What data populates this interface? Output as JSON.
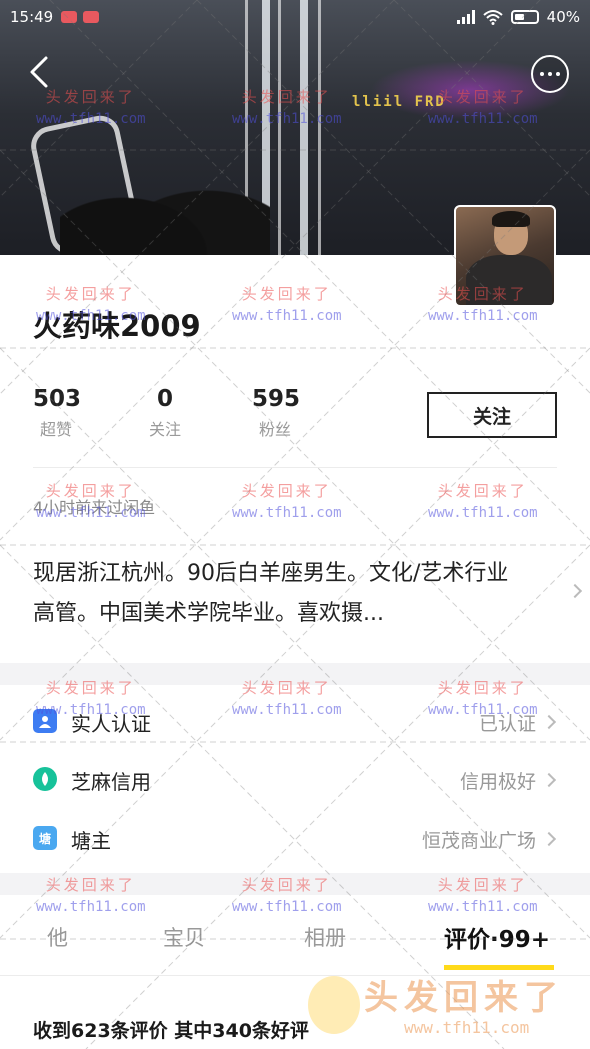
{
  "status_bar": {
    "time": "15:49",
    "battery": "40%"
  },
  "cover_sign": "lliil FRD",
  "profile": {
    "name": "火药味2009",
    "stats": [
      {
        "value": "503",
        "label": "超赞"
      },
      {
        "value": "0",
        "label": "关注"
      },
      {
        "value": "595",
        "label": "粉丝"
      }
    ],
    "follow_label": "关注",
    "last_seen": "4小时前来过闲鱼",
    "bio": "现居浙江杭州。90后白羊座男生。文化/艺术行业高管。中国美术学院毕业。喜欢摄..."
  },
  "info_rows": [
    {
      "icon": "id-badge-icon",
      "label": "实人认证",
      "value": "已认证",
      "icon_color": "#3d7cf2"
    },
    {
      "icon": "sesame-credit-icon",
      "label": "芝麻信用",
      "value": "信用极好",
      "icon_color": "#17c29a"
    },
    {
      "icon": "pond-icon",
      "label": "塘主",
      "value": "恒茂商业广场",
      "icon_color": "#4aa8f0",
      "icon_text": "塘"
    }
  ],
  "tabs": [
    {
      "label": "他",
      "active": false
    },
    {
      "label": "宝贝",
      "active": false
    },
    {
      "label": "相册",
      "active": false
    },
    {
      "label": "评价·99+",
      "active": true
    }
  ],
  "review_summary": "收到623条评价 其中340条好评",
  "watermark": {
    "text": "头发回来了",
    "url": "www.tfh11.com",
    "logo_text": "头发回来了",
    "logo_url": "www.tfh11.com"
  },
  "colors": {
    "accent_yellow": "#ffda1a",
    "page_bg": "#ffffff",
    "section_gap": "#f3f3f5"
  }
}
